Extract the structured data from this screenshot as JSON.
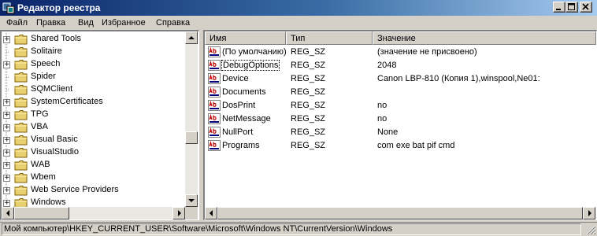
{
  "window": {
    "title": "Редактор реестра",
    "icon": "registry-editor-icon",
    "title_bar_color": "#0a246a"
  },
  "menu": {
    "items": [
      {
        "label": "Файл"
      },
      {
        "label": "Правка"
      },
      {
        "label": "Вид"
      },
      {
        "label": "Избранное"
      },
      {
        "label": "Справка"
      }
    ]
  },
  "tree": {
    "items": [
      {
        "label": "Shared Tools",
        "expandable": true
      },
      {
        "label": "Solitaire",
        "expandable": false
      },
      {
        "label": "Speech",
        "expandable": true
      },
      {
        "label": "Spider",
        "expandable": false
      },
      {
        "label": "SQMClient",
        "expandable": false
      },
      {
        "label": "SystemCertificates",
        "expandable": true
      },
      {
        "label": "TPG",
        "expandable": true
      },
      {
        "label": "VBA",
        "expandable": true
      },
      {
        "label": "Visual Basic",
        "expandable": true
      },
      {
        "label": "VisualStudio",
        "expandable": true
      },
      {
        "label": "WAB",
        "expandable": true
      },
      {
        "label": "Wbem",
        "expandable": true
      },
      {
        "label": "Web Service Providers",
        "expandable": true
      },
      {
        "label": "Windows",
        "expandable": true
      }
    ]
  },
  "values": {
    "columns": {
      "name": "Имя",
      "type": "Тип",
      "data": "Значение"
    },
    "rows": [
      {
        "name": "(По умолчанию)",
        "type": "REG_SZ",
        "data": "(значение не присвоено)"
      },
      {
        "name": "DebugOptions",
        "type": "REG_SZ",
        "data": "2048",
        "selected": true
      },
      {
        "name": "Device",
        "type": "REG_SZ",
        "data": "Canon LBP-810 (Копия 1),winspool,Ne01:"
      },
      {
        "name": "Documents",
        "type": "REG_SZ",
        "data": ""
      },
      {
        "name": "DosPrint",
        "type": "REG_SZ",
        "data": "no"
      },
      {
        "name": "NetMessage",
        "type": "REG_SZ",
        "data": "no"
      },
      {
        "name": "NullPort",
        "type": "REG_SZ",
        "data": "None"
      },
      {
        "name": "Programs",
        "type": "REG_SZ",
        "data": "com exe bat pif cmd"
      }
    ]
  },
  "statusbar": {
    "path": "Мой компьютер\\HKEY_CURRENT_USER\\Software\\Microsoft\\Windows NT\\CurrentVersion\\Windows"
  }
}
